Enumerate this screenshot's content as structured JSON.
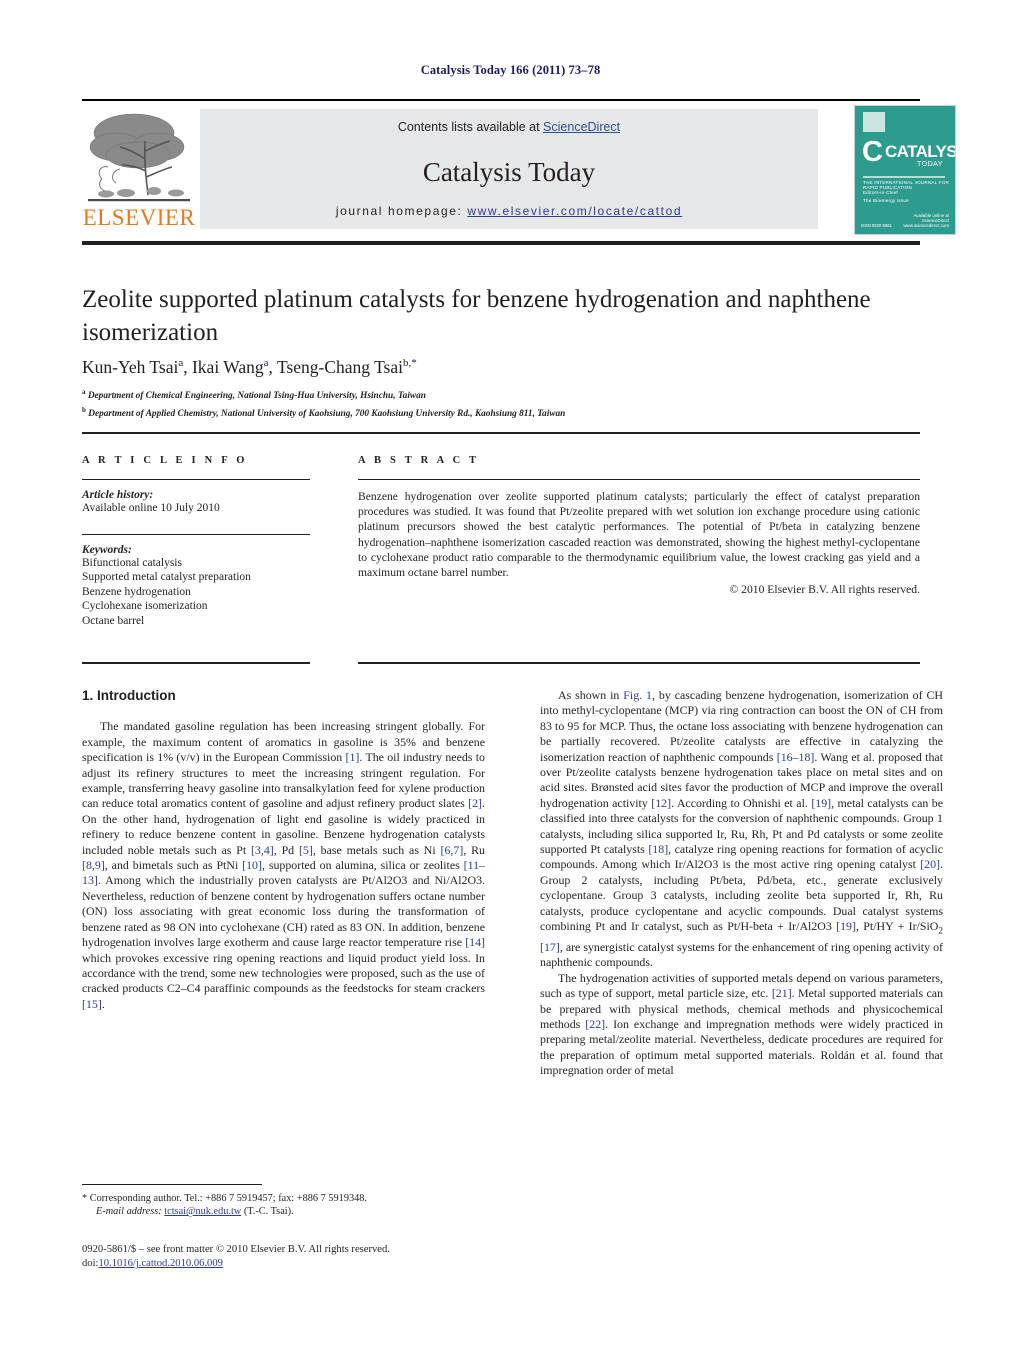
{
  "running_head": "Catalysis Today 166 (2011) 73–78",
  "masthead": {
    "contents_prefix": "Contents lists available at ",
    "sciencedirect": "ScienceDirect",
    "journal_name": "Catalysis Today",
    "homepage_label": "journal homepage:",
    "homepage_url": "www.elsevier.com/locate/cattod",
    "publisher_logo_text": "ELSEVIER",
    "cover": {
      "brand_initial": "C",
      "title": "CATALYSIS",
      "subtitle": "TODAY",
      "strapline": "THE INTERNATIONAL JOURNAL FOR RAPID PUBLICATION",
      "line_a": "Editors-in-Chief",
      "line_b": "The Bioenergy Issue",
      "availability": "Available online at",
      "vendor": "ScienceDirect",
      "vendor_url": "www.sciencedirect.com",
      "issn_line": "ISSN 0920-5861"
    },
    "accent_orange": "#e87722",
    "accent_blue": "#2c3b96",
    "cover_teal": "#2e9b8f",
    "band_grey": "#e6e7e8"
  },
  "article": {
    "title": "Zeolite supported platinum catalysts for benzene hydrogenation and naphthene isomerization",
    "authors_html": "Kun-Yeh Tsai<sup>a</sup>, Ikai Wang<sup>a</sup>, Tseng-Chang Tsai<sup>b,</sup><sup>*</sup>",
    "affiliation_a_marker": "a",
    "affiliation_a": "Department of Chemical Engineering, National Tsing-Hua University, Hsinchu, Taiwan",
    "affiliation_b_marker": "b",
    "affiliation_b": "Department of Applied Chemistry, National University of Kaohsiung, 700 Kaohsiung University Rd., Kaohsiung 811, Taiwan"
  },
  "article_info": {
    "heading": "A R T I C L E   I N F O",
    "history_label": "Article history:",
    "history_value": "Available online 10 July 2010",
    "keywords_label": "Keywords:",
    "keywords": [
      "Bifunctional catalysis",
      "Supported metal catalyst preparation",
      "Benzene hydrogenation",
      "Cyclohexane isomerization",
      "Octane barrel"
    ]
  },
  "abstract": {
    "heading": "A B S T R A C T",
    "text": "Benzene hydrogenation over zeolite supported platinum catalysts; particularly the effect of catalyst preparation procedures was studied. It was found that Pt/zeolite prepared with wet solution ion exchange procedure using cationic platinum precursors showed the best catalytic performances. The potential of Pt/beta in catalyzing benzene hydrogenation–naphthene isomerization cascaded reaction was demonstrated, showing the highest methyl-cyclopentane to cyclohexane product ratio comparable to the thermodynamic equilibrium value, the lowest cracking gas yield and a maximum octane barrel number.",
    "copyright": "© 2010 Elsevier B.V. All rights reserved."
  },
  "body": {
    "section_number_title": "1.  Introduction",
    "left_paragraph_1": "The mandated gasoline regulation has been increasing stringent globally. For example, the maximum content of aromatics in gasoline is 35% and benzene specification is 1% (v/v) in the European Commission [1]. The oil industry needs to adjust its refinery structures to meet the increasing stringent regulation. For example, transferring heavy gasoline into transalkylation feed for xylene production can reduce total aromatics content of gasoline and adjust refinery product slates [2]. On the other hand, hydrogenation of light end gasoline is widely practiced in refinery to reduce benzene content in gasoline. Benzene hydrogenation catalysts included noble metals such as Pt [3,4], Pd [5], base metals such as Ni [6,7], Ru [8,9], and bimetals such as PtNi [10], supported on alumina, silica or zeolites [11–13]. Among which the industrially proven catalysts are Pt/Al2O3 and Ni/Al2O3. Nevertheless, reduction of benzene content by hydrogenation suffers octane number (ON) loss associating with great economic loss during the transformation of benzene rated as 98 ON into cyclohexane (CH) rated as 83 ON. In addition, benzene hydrogenation involves large exotherm and cause large reactor temperature rise [14] which provokes excessive ring opening reactions and liquid product yield loss. In accordance with the trend, some new technologies were proposed, such as the use of cracked products C2–C4 paraffinic compounds as the feedstocks for steam crackers [15].",
    "right_paragraph_1": "As shown in Fig. 1, by cascading benzene hydrogenation, isomerization of CH into methyl-cyclopentane (MCP) via ring contraction can boost the ON of CH from 83 to 95 for MCP. Thus, the octane loss associating with benzene hydrogenation can be partially recovered. Pt/zeolite catalysts are effective in catalyzing the isomerization reaction of naphthenic compounds [16–18]. Wang et al. proposed that over Pt/zeolite catalysts benzene hydrogenation takes place on metal sites and on acid sites. Brønsted acid sites favor the production of MCP and improve the overall hydrogenation activity [12]. According to Ohnishi et al. [19], metal catalysts can be classified into three catalysts for the conversion of naphthenic compounds. Group 1 catalysts, including silica supported Ir, Ru, Rh, Pt and Pd catalysts or some zeolite supported Pt catalysts [18], catalyze ring opening reactions for formation of acyclic compounds. Among which Ir/Al2O3 is the most active ring opening catalyst [20]. Group 2 catalysts, including Pt/beta, Pd/beta, etc., generate exclusively cyclopentane. Group 3 catalysts, including zeolite beta supported Ir, Rh, Ru catalysts, produce cyclopentane and acyclic compounds. Dual catalyst systems combining Pt and Ir catalyst, such as Pt/H-beta + Ir/Al2O3 [19], Pt/HY + Ir/SiO2 [17], are synergistic catalyst systems for the enhancement of ring opening activity of naphthenic compounds.",
    "right_paragraph_2": "The hydrogenation activities of supported metals depend on various parameters, such as type of support, metal particle size, etc. [21]. Metal supported materials can be prepared with physical methods, chemical methods and physicochemical methods [22]. Ion exchange and impregnation methods were widely practiced in preparing metal/zeolite material. Nevertheless, dedicate procedures are required for the preparation of optimum metal supported materials. Roldán et al. found that impregnation order of metal"
  },
  "footer": {
    "corresponding_marker": "*",
    "corresponding_text": "Corresponding author. Tel.: +886 7 5919457; fax: +886 7 5919348.",
    "email_label": "E-mail address:",
    "email": "tctsai@nuk.edu.tw",
    "email_owner": "(T.-C. Tsai).",
    "imprint_line": "0920-5861/$ – see front matter © 2010 Elsevier B.V. All rights reserved.",
    "doi_label": "doi:",
    "doi_value": "10.1016/j.cattod.2010.06.009"
  }
}
